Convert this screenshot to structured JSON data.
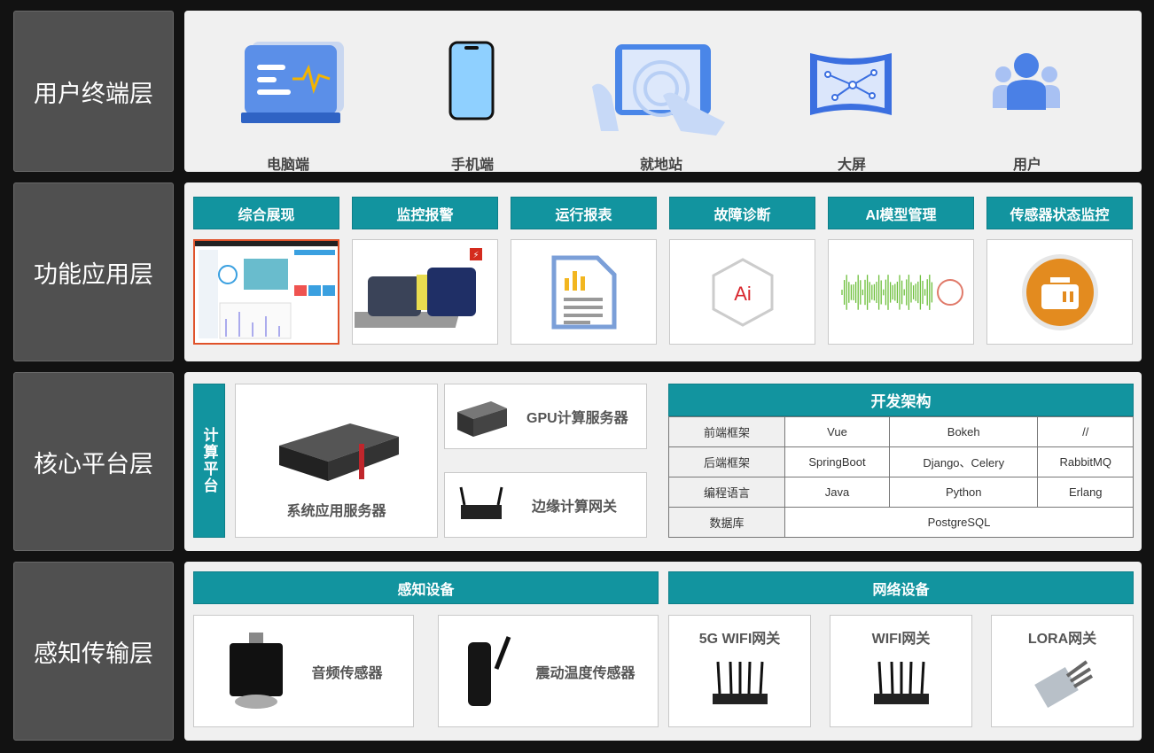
{
  "layers": [
    "用户终端层",
    "功能应用层",
    "核心平台层",
    "感知传输层"
  ],
  "terminals": [
    {
      "label": "电脑端",
      "icon": "computer-icon"
    },
    {
      "label": "手机端",
      "icon": "phone-icon"
    },
    {
      "label": "就地站",
      "icon": "tablet-touch-icon"
    },
    {
      "label": "大屏",
      "icon": "big-screen-icon"
    },
    {
      "label": "用户",
      "icon": "users-icon"
    }
  ],
  "functions": [
    "综合展现",
    "监控报警",
    "运行报表",
    "故障诊断",
    "AI模型管理",
    "传感器状态监控"
  ],
  "diagnosis_icon_text": "Ai",
  "platform": {
    "compute_label": "计算平台",
    "server": "系统应用服务器",
    "gpu": "GPU计算服务器",
    "edge": "边缘计算网关",
    "dev_title": "开发架构",
    "rows": [
      [
        "前端框架",
        "Vue",
        "Bokeh",
        "//"
      ],
      [
        "后端框架",
        "SpringBoot",
        "Django、Celery",
        "RabbitMQ"
      ],
      [
        "编程语言",
        "Java",
        "Python",
        "Erlang"
      ],
      [
        "数据库",
        "PostgreSQL"
      ]
    ]
  },
  "perception": {
    "sensing_title": "感知设备",
    "network_title": "网络设备",
    "sensors": [
      "音频传感器",
      "震动温度传感器"
    ],
    "network": [
      "5G WIFI网关",
      "WIFI网关",
      "LORA网关"
    ]
  },
  "colors": {
    "teal": "#12949f",
    "layer_bg": "#505050",
    "panel_bg": "#f0f0f0"
  }
}
